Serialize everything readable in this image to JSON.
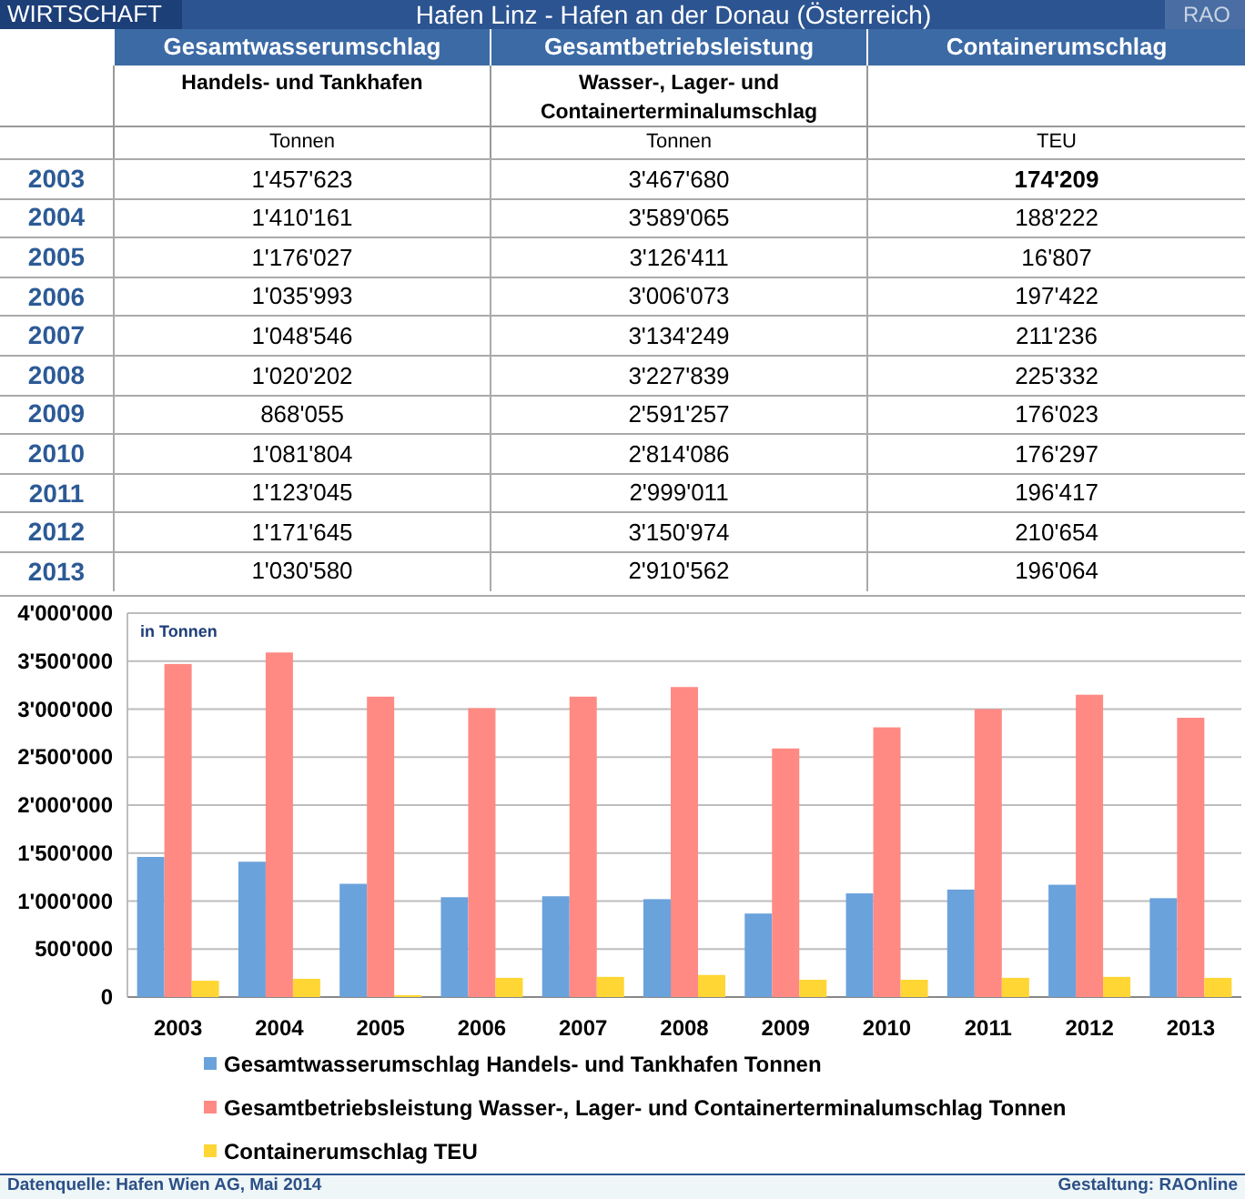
{
  "top_bar": {
    "section": "WIRTSCHAFT",
    "title": "Hafen Linz - Hafen an der Donau (Österreich)",
    "logo": "RAO"
  },
  "table": {
    "columns": [
      {
        "title": "Gesamtwasserumschlag",
        "subtitle": "Handels- und Tankhafen",
        "unit": "Tonnen"
      },
      {
        "title": "Gesamtbetriebsleistung",
        "subtitle": "Wasser-, Lager- und Containerterminalumschlag",
        "unit": "Tonnen"
      },
      {
        "title": "Containerumschlag",
        "unit": "TEU"
      }
    ],
    "rows": [
      {
        "year": "2003",
        "values": [
          "1'457'623",
          "3'467'680",
          "174'209"
        ],
        "highlighted": true
      },
      {
        "year": "2004",
        "values": [
          "1'410'161",
          "3'589'065",
          "188'222"
        ],
        "highlighted": false
      },
      {
        "year": "2005",
        "values": [
          "1'176'027",
          "3'126'411",
          "16'807"
        ],
        "highlighted": false
      },
      {
        "year": "2006",
        "values": [
          "1'035'993",
          "3'006'073",
          "197'422"
        ],
        "highlighted": false
      },
      {
        "year": "2007",
        "values": [
          "1'048'546",
          "3'134'249",
          "211'236"
        ],
        "highlighted": false
      },
      {
        "year": "2008",
        "values": [
          "1'020'202",
          "3'227'839",
          "225'332"
        ],
        "highlighted": false
      },
      {
        "year": "2009",
        "values": [
          "868'055",
          "2'591'257",
          "176'023"
        ],
        "highlighted": false
      },
      {
        "year": "2010",
        "values": [
          "1'081'804",
          "2'814'086",
          "176'297"
        ],
        "highlighted": false
      },
      {
        "year": "2011",
        "values": [
          "1'123'045",
          "2'999'011",
          "196'417"
        ],
        "highlighted": false
      },
      {
        "year": "2012",
        "values": [
          "1'171'645",
          "3'150'974",
          "210'654"
        ],
        "highlighted": false
      },
      {
        "year": "2013",
        "values": [
          "1'030'580",
          "2'910'562",
          "196'064"
        ],
        "highlighted": false
      }
    ]
  },
  "chart": {
    "chart_data": {
      "type": "bar",
      "categories": [
        "2003",
        "2004",
        "2005",
        "2006",
        "2007",
        "2008",
        "2009",
        "2010",
        "2011",
        "2012",
        "2013"
      ],
      "series": [
        {
          "name": "Gesamtwasserumschlag Handels- und Tankhafen Tonnen",
          "color": "#6aa2dc",
          "values": [
            1460000,
            1410000,
            1180000,
            1040000,
            1050000,
            1020000,
            870000,
            1080000,
            1120000,
            1170000,
            1030000
          ]
        },
        {
          "name": "Gesamtbetriebsleistung Wasser-, Lager- und Containerterminalumschlag Tonnen",
          "color": "#ff8a84",
          "values": [
            3470000,
            3590000,
            3130000,
            3010000,
            3130000,
            3230000,
            2590000,
            2810000,
            3000000,
            3150000,
            2910000
          ]
        },
        {
          "name": "Containerumschlag TEU",
          "color": "#ffd633",
          "values": [
            170000,
            190000,
            20000,
            200000,
            210000,
            230000,
            180000,
            180000,
            200000,
            210000,
            200000
          ]
        }
      ],
      "ylim": [
        0,
        4000000
      ],
      "grid": true,
      "yticks": [
        {
          "value": 0,
          "label": "0"
        },
        {
          "value": 500000,
          "label": "500'000"
        },
        {
          "value": 1000000,
          "label": "1'000'000"
        },
        {
          "value": 1500000,
          "label": "1'500'000"
        },
        {
          "value": 2000000,
          "label": "2'000'000"
        },
        {
          "value": 2500000,
          "label": "2'500'000"
        },
        {
          "value": 3000000,
          "label": "3'000'000"
        },
        {
          "value": 3500000,
          "label": "3'500'000"
        },
        {
          "value": 4000000,
          "label": "4'000'000"
        }
      ],
      "annotations": [
        {
          "text": "in Tonnen"
        }
      ]
    }
  },
  "footer": {
    "source": "Datenquelle: Hafen Wien AG, Mai 2014",
    "credit": "Gestaltung: RAOnline"
  }
}
